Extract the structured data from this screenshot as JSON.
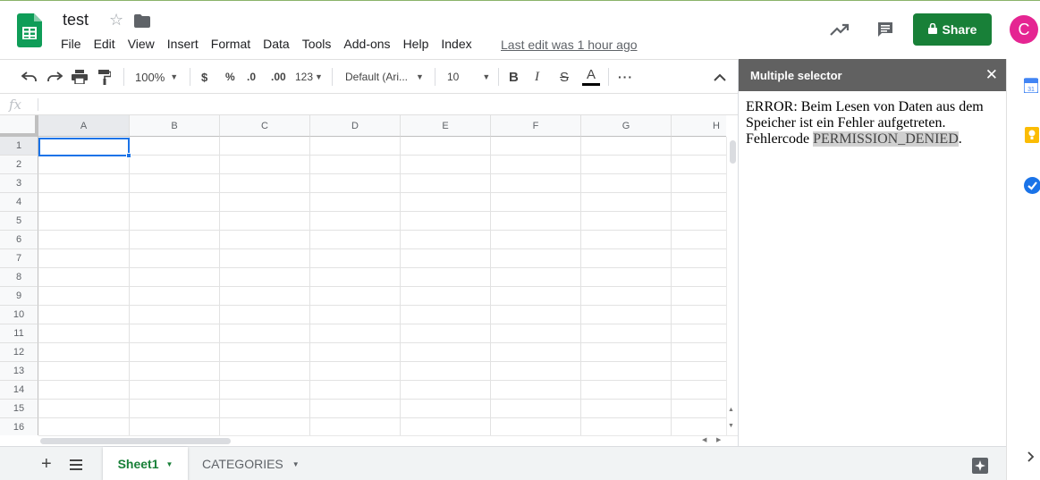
{
  "header": {
    "doc_title": "test",
    "menu": [
      "File",
      "Edit",
      "View",
      "Insert",
      "Format",
      "Data",
      "Tools",
      "Add-ons",
      "Help",
      "Index"
    ],
    "last_edit": "Last edit was 1 hour ago",
    "share_label": "Share",
    "avatar_letter": "C"
  },
  "toolbar": {
    "zoom": "100%",
    "currency": "$",
    "percent": "%",
    "dec_decrease": ".0",
    "dec_increase": ".00",
    "more_formats": "123",
    "font": "Default (Ari...",
    "font_size": "10",
    "bold": "B",
    "italic": "I",
    "strike": "S",
    "text_color": "A"
  },
  "formula_bar": {
    "fx_label": "fx"
  },
  "grid": {
    "columns": [
      "A",
      "B",
      "C",
      "D",
      "E",
      "F",
      "G",
      "H"
    ],
    "rows": [
      "1",
      "2",
      "3",
      "4",
      "5",
      "6",
      "7",
      "8",
      "9",
      "10",
      "11",
      "12",
      "13",
      "14",
      "15",
      "16"
    ]
  },
  "sheets": {
    "tabs": [
      "Sheet1",
      "CATEGORIES"
    ],
    "active": "Sheet1"
  },
  "panel": {
    "title": "Multiple selector",
    "message_prefix": "ERROR: Beim Lesen von Daten aus dem Speicher ist ein Fehler aufgetreten. Fehlercode ",
    "error_code": "PERMISSION_DENIED",
    "message_suffix": "."
  },
  "colors": {
    "brand_green": "#188038",
    "avatar_pink": "#e52592",
    "panel_header": "#616161",
    "selection_blue": "#1a73e8"
  }
}
